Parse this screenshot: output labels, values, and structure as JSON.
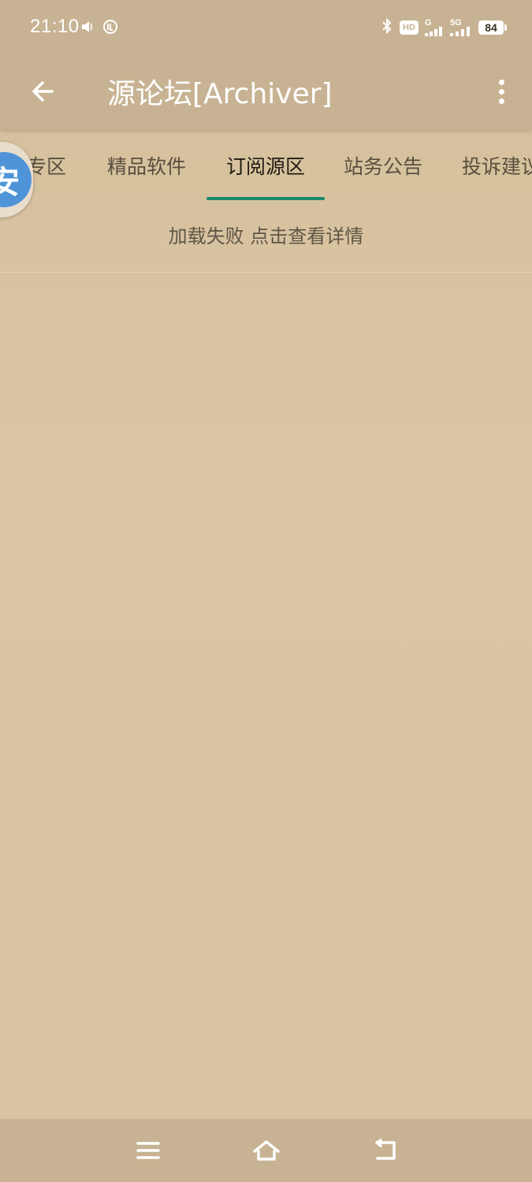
{
  "status_bar": {
    "time": "21:10",
    "network_badge_top": "5G",
    "network_badge_small": "G",
    "hd_label": "HD",
    "battery": "84"
  },
  "app_bar": {
    "title": "源论坛[Archiver]"
  },
  "tabs": [
    {
      "label": "技术专区"
    },
    {
      "label": "精品软件"
    },
    {
      "label": "订阅源区",
      "active": true
    },
    {
      "label": "站务公告"
    },
    {
      "label": "投诉建议"
    }
  ],
  "floating_badge": {
    "char": "安"
  },
  "content": {
    "load_error": "加载失败 点击查看详情"
  },
  "colors": {
    "bar": "#c7b393",
    "background": "#d9c4a1",
    "tab_indicator": "#1a8a6a"
  }
}
